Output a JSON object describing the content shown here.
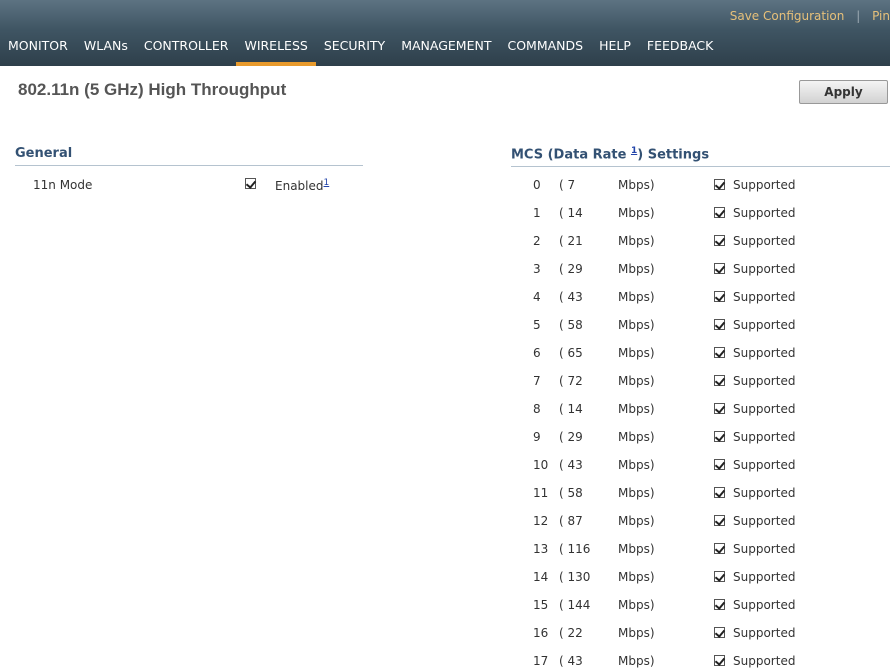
{
  "top_links": {
    "save": "Save Configuration",
    "separator": "|",
    "ping": "Pin"
  },
  "nav": [
    {
      "label": "MONITOR"
    },
    {
      "label": "WLANs"
    },
    {
      "label": "CONTROLLER"
    },
    {
      "label": "WIRELESS",
      "active": true
    },
    {
      "label": "SECURITY"
    },
    {
      "label": "MANAGEMENT"
    },
    {
      "label": "COMMANDS"
    },
    {
      "label": "HELP"
    },
    {
      "label": "FEEDBACK"
    }
  ],
  "page": {
    "title": "802.11n (5 GHz) High Throughput",
    "apply_label": "Apply"
  },
  "general": {
    "title": "General",
    "mode_label": "11n Mode",
    "mode_checked": true,
    "enabled_label": "Enabled",
    "enabled_footnote": "1"
  },
  "mcs": {
    "title_prefix": "MCS (Data Rate ",
    "title_footnote": "1",
    "title_suffix": ") Settings",
    "unit": "Mbps)",
    "supported_label": "Supported",
    "rows": [
      {
        "index": "0",
        "rate": "( 7"
      },
      {
        "index": "1",
        "rate": "( 14"
      },
      {
        "index": "2",
        "rate": "( 21"
      },
      {
        "index": "3",
        "rate": "( 29"
      },
      {
        "index": "4",
        "rate": "( 43"
      },
      {
        "index": "5",
        "rate": "( 58"
      },
      {
        "index": "6",
        "rate": "( 65"
      },
      {
        "index": "7",
        "rate": "( 72"
      },
      {
        "index": "8",
        "rate": "( 14"
      },
      {
        "index": "9",
        "rate": "( 29"
      },
      {
        "index": "10",
        "rate": "( 43"
      },
      {
        "index": "11",
        "rate": "( 58"
      },
      {
        "index": "12",
        "rate": "( 87"
      },
      {
        "index": "13",
        "rate": "( 116"
      },
      {
        "index": "14",
        "rate": "( 130"
      },
      {
        "index": "15",
        "rate": "( 144"
      },
      {
        "index": "16",
        "rate": "( 22"
      },
      {
        "index": "17",
        "rate": "( 43"
      }
    ]
  },
  "colors": {
    "accent": "#e89a2c",
    "header_bg": "#3f5563",
    "section_title": "#335173"
  }
}
